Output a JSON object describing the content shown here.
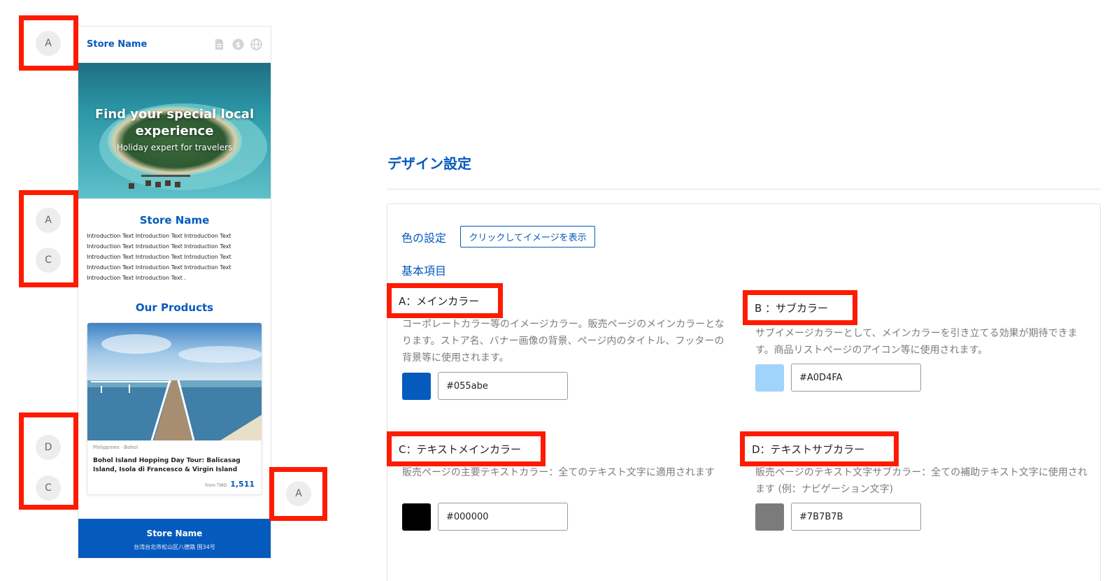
{
  "preview": {
    "header_store": "Store Name",
    "header_icons": [
      "document-icon",
      "dollar-icon",
      "globe-icon"
    ],
    "hero_title": "Find your special local experience",
    "hero_sub": "Holiday expert for travelers",
    "store_name": "Store Name",
    "intro": "Introduction Text Introduction Text Introduction Text Introduction Text Introduction Text Introduction Text Introduction Text Introduction Text Introduction Text Introduction Text Introduction Text Introduction Text Introduction Text Introduction Text .",
    "products_title": "Our Products",
    "product": {
      "location": "Philippines · Bohol",
      "title": "Bohol Island Hopping Day Tour: Balicasag Island, Isola di Francesco & Virgin Island",
      "price_from": "From TWD",
      "price": "1,511"
    },
    "footer_name": "Store Name",
    "footer_addr": "台湾台北市松山区八德路 国34号"
  },
  "badges": [
    "A",
    "A",
    "C",
    "D",
    "C",
    "A"
  ],
  "settings": {
    "title": "デザイン設定",
    "color_label": "色の設定",
    "show_button": "クリックしてイメージを表示",
    "basic_label": "基本項目",
    "items": [
      {
        "label": "A：メインカラー",
        "desc": "コーポレートカラー等のイメージカラー。販売ページのメインカラーとなります。ストア名、バナー画像の背景、ページ内のタイトル、フッターの背景等に使用されます。",
        "value": "#055abe",
        "color": "#055abe"
      },
      {
        "label": "B ：サブカラー",
        "desc": "サブイメージカラーとして、メインカラーを引き立てる効果が期待できます。商品リストページのアイコン等に使用されます。",
        "value": "#A0D4FA",
        "color": "#A0D4FA"
      },
      {
        "label": "C：テキストメインカラー",
        "desc": "販売ページの主要テキストカラー：全てのテキスト文字に適用されます",
        "value": "#000000",
        "color": "#000000"
      },
      {
        "label": "D：テキストサブカラー",
        "desc": "販売ページのテキスト文字サブカラー：全ての補助テキスト文字に使用されます (例：ナビゲーション文字)",
        "value": "#7B7B7B",
        "color": "#7B7B7B"
      }
    ]
  },
  "colors": {
    "highlight": "#ff1a00",
    "accent": "#055abe"
  }
}
